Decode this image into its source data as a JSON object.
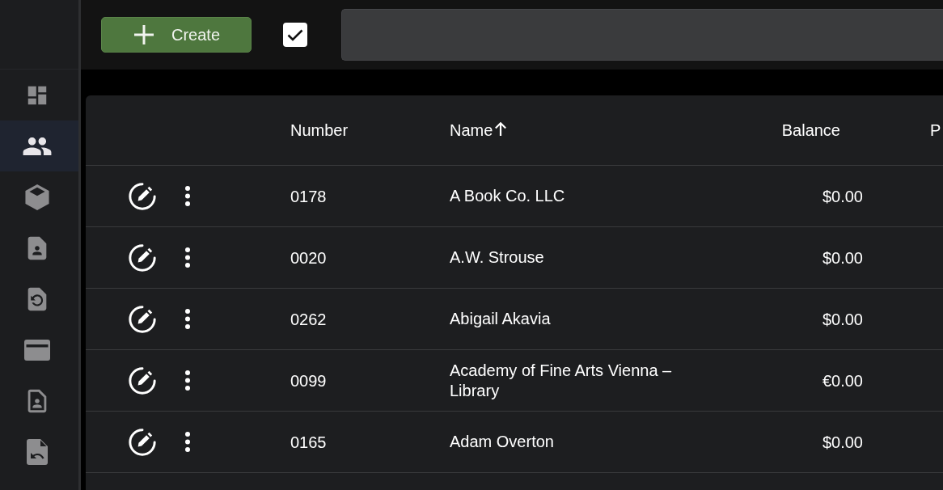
{
  "sidebar": {
    "items": [
      {
        "selected": false
      },
      {
        "selected": true
      },
      {
        "selected": false
      },
      {
        "selected": false
      },
      {
        "selected": false
      },
      {
        "selected": false
      },
      {
        "selected": false
      },
      {
        "selected": false
      }
    ]
  },
  "toolbar": {
    "create_button": {
      "label": "Create"
    },
    "checkbox": {
      "checked": true
    }
  },
  "table": {
    "columns": [
      {
        "label": "Number",
        "sorted": false
      },
      {
        "label": "Name",
        "sorted": true
      },
      {
        "label": "Balance",
        "sorted": false
      },
      {
        "label": "P",
        "sorted": false
      }
    ],
    "rows": [
      {
        "number": "0178",
        "name": "A Book Co. LLC",
        "balance": "$0.00"
      },
      {
        "number": "0020",
        "name": "A.W. Strouse",
        "balance": "$0.00"
      },
      {
        "number": "0262",
        "name": "Abigail Akavia",
        "balance": "$0.00"
      },
      {
        "number": "0099",
        "name": "Academy of Fine Arts Vienna – Library",
        "balance": "€0.00"
      },
      {
        "number": "0165",
        "name": "Adam Overton",
        "balance": "$0.00"
      }
    ]
  }
}
